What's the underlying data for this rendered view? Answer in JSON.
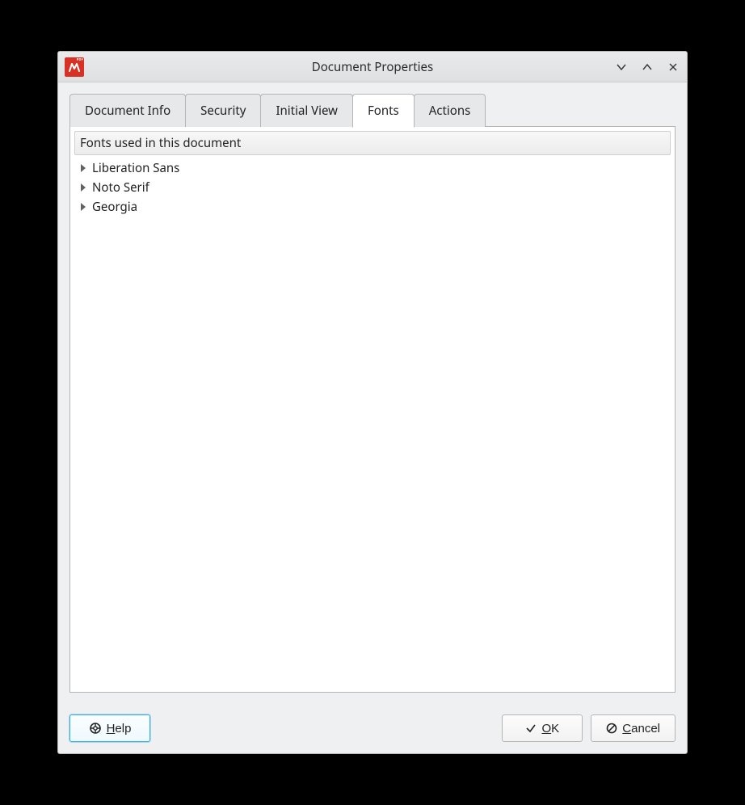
{
  "titlebar": {
    "app_icon_label": "PDF",
    "title": "Document Properties"
  },
  "tabs": [
    {
      "label": "Document Info",
      "active": false
    },
    {
      "label": "Security",
      "active": false
    },
    {
      "label": "Initial View",
      "active": false
    },
    {
      "label": "Fonts",
      "active": true
    },
    {
      "label": "Actions",
      "active": false
    }
  ],
  "fonts_panel": {
    "header": "Fonts used in this document",
    "items": [
      {
        "name": "Liberation Sans"
      },
      {
        "name": "Noto Serif"
      },
      {
        "name": "Georgia"
      }
    ]
  },
  "buttons": {
    "help": "Help",
    "ok": "OK",
    "cancel": "Cancel"
  }
}
